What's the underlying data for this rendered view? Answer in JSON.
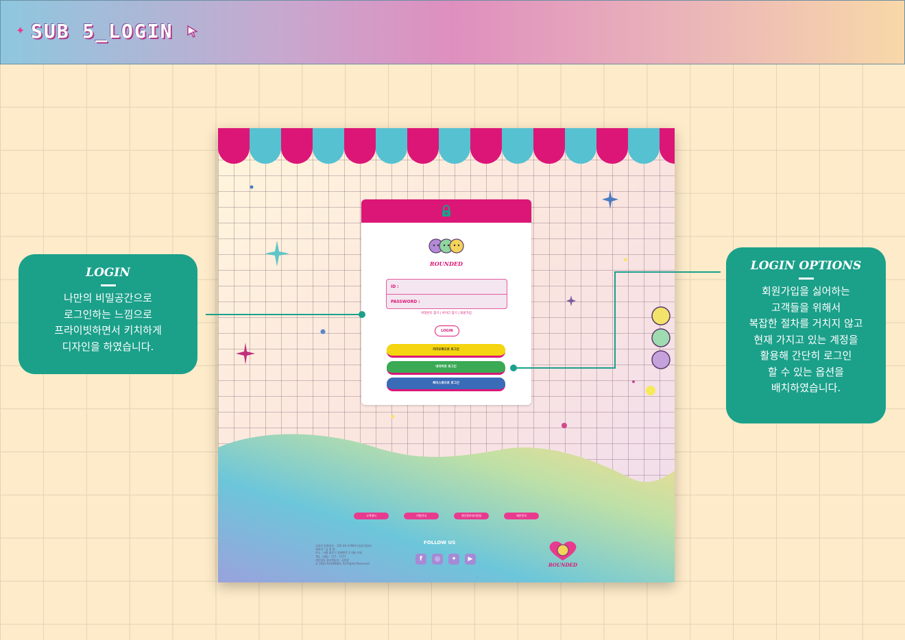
{
  "header": {
    "title": "SUB 5_LOGIN",
    "spark_icon": "sparkle-icon",
    "cursor_icon": "cursor-arrow-icon"
  },
  "login_card": {
    "lock_icon": "lock-icon",
    "brand": "ROUNDED",
    "id_label": "ID :",
    "password_label": "PASSWORD :",
    "links": "비밀번호 찾기 | 아이디 찾기 | 회원가입",
    "login_button": "LOGIN",
    "social": [
      {
        "label": "카카오톡으로 로그인",
        "color": "#f5d50f",
        "text_color": "#3a3020"
      },
      {
        "label": "네이버로 로그인",
        "color": "#3aaa55",
        "text_color": "#ffffff"
      },
      {
        "label": "페이스북으로 로그인",
        "color": "#3a6bb8",
        "text_color": "#ffffff"
      }
    ]
  },
  "footer": {
    "pills": [
      "고객센터",
      "이용안내",
      "개인정보처리방침",
      "제안문의"
    ],
    "info": [
      "사업자 등록번호 : 105-46-47964 [사업자정보]",
      "대표자 : 김 정 현",
      "주소 : 서울 종로구 청계천로 2 대표 타워",
      "TEL : 060 - 777 - 7777",
      "개인정보 관리책임자 : 김미은",
      "© 2022 ROUNDED. All Rights Reserved."
    ],
    "follow_us": "FOLLOW US",
    "sns": [
      "facebook-icon",
      "instagram-icon",
      "twitter-icon",
      "youtube-icon"
    ],
    "brand": "ROUNDED"
  },
  "callouts": {
    "login": {
      "title": "LOGIN",
      "body": [
        "나만의 비밀공간으로",
        "로그인하는 느낌으로",
        "프라이빗하면서 키치하게",
        "디자인을 하였습니다."
      ]
    },
    "options": {
      "title": "LOGIN OPTIONS",
      "body": [
        "회원가입을 싫어하는",
        "고객들을 위해서",
        "복잡한 절차를 거치지 않고",
        "현재 가지고 있는 계정을",
        "활용해 간단히 로그인",
        "할 수 있는 옵션을",
        "배치하였습니다."
      ]
    }
  },
  "colors": {
    "accent": "#dc1677",
    "teal": "#1ba08a",
    "awning_blue": "#56c1d1"
  }
}
